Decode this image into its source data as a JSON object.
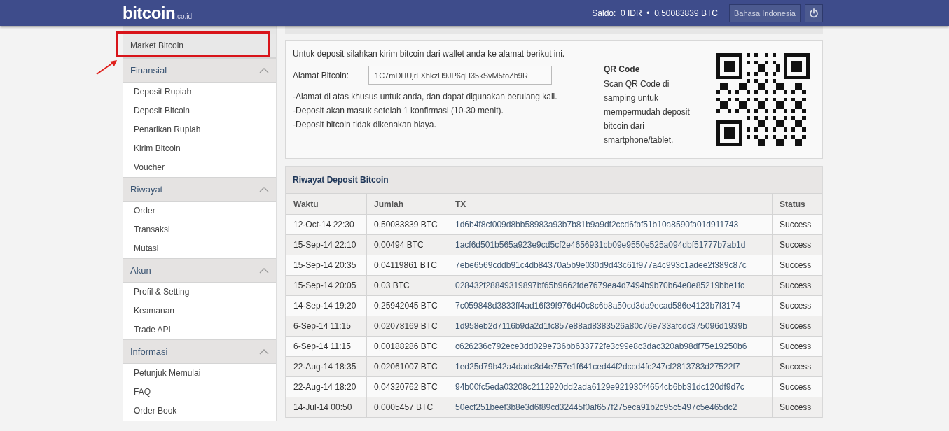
{
  "header": {
    "logo_text": "bitcoin",
    "logo_suffix": ".co.id",
    "balance_label": "Saldo:",
    "balance_idr": "0 IDR",
    "balance_separator": "•",
    "balance_btc": "0,50083839 BTC",
    "language_button": "Bahasa Indonesia"
  },
  "sidebar": {
    "top_item": {
      "label": "Market Bitcoin",
      "selected": true,
      "highlighted": true
    },
    "sections": [
      {
        "title": "Finansial",
        "expanded": true,
        "items": [
          "Deposit Rupiah",
          "Deposit Bitcoin",
          "Penarikan Rupiah",
          "Kirim Bitcoin",
          "Voucher"
        ]
      },
      {
        "title": "Riwayat",
        "expanded": true,
        "items": [
          "Order",
          "Transaksi",
          "Mutasi"
        ]
      },
      {
        "title": "Akun",
        "expanded": true,
        "items": [
          "Profil & Setting",
          "Keamanan",
          "Trade API"
        ]
      },
      {
        "title": "Informasi",
        "expanded": true,
        "items": [
          "Petunjuk Memulai",
          "FAQ",
          "Order Book"
        ]
      }
    ]
  },
  "deposit": {
    "intro": "Untuk deposit silahkan kirim bitcoin dari wallet anda ke alamat berikut ini.",
    "address_label": "Alamat Bitcoin:",
    "address": "1C7mDHUjrLXhkzH9JP6qH35kSvM5foZb9R",
    "notes": [
      "-Alamat di atas khusus untuk anda, dan dapat digunakan berulang kali.",
      "-Deposit akan masuk setelah 1 konfirmasi (10-30 menit).",
      "-Deposit bitcoin tidak dikenakan biaya."
    ],
    "qr_title": "QR Code",
    "qr_text": "Scan QR Code di samping untuk mempermudah deposit bitcoin dari smartphone/tablet."
  },
  "history": {
    "title": "Riwayat Deposit Bitcoin",
    "columns": [
      "Waktu",
      "Jumlah",
      "TX",
      "Status"
    ],
    "rows": [
      [
        "12-Oct-14 22:30",
        "0,50083839 BTC",
        "1d6b4f8cf009d8bb58983a93b7b81b9a9df2ccd6fbf51b10a8590fa01d911743",
        "Success"
      ],
      [
        "15-Sep-14 22:10",
        "0,00494 BTC",
        "1acf6d501b565a923e9cd5cf2e4656931cb09e9550e525a094dbf51777b7ab1d",
        "Success"
      ],
      [
        "15-Sep-14 20:35",
        "0,04119861 BTC",
        "7ebe6569cddb91c4db84370a5b9e030d9d43c61f977a4c993c1adee2f389c87c",
        "Success"
      ],
      [
        "15-Sep-14 20:05",
        "0,03 BTC",
        "028432f28849319897bf65b9662fde7679ea4d7494b9b70b64e0e85219bbe1fc",
        "Success"
      ],
      [
        "14-Sep-14 19:20",
        "0,25942045 BTC",
        "7c059848d3833ff4ad16f39f976d40c8c6b8a50cd3da9ecad586e4123b7f3174",
        "Success"
      ],
      [
        "6-Sep-14 11:15",
        "0,02078169 BTC",
        "1d958eb2d7116b9da2d1fc857e88ad8383526a80c76e733afcdc375096d1939b",
        "Success"
      ],
      [
        "6-Sep-14 11:15",
        "0,00188286 BTC",
        "c626236c792ece3dd029e736bb633772fe3c99e8c3dac320ab98df75e19250b6",
        "Success"
      ],
      [
        "22-Aug-14 18:35",
        "0,02061007 BTC",
        "1ed25d79b42a4dadc8d4e757e1f641ced44f2dccd4fc247cf2813783d27522f7",
        "Success"
      ],
      [
        "22-Aug-14 18:20",
        "0,04320762 BTC",
        "94b00fc5eda03208c2112920dd2ada6129e921930f4654cb6bb31dc120df9d7c",
        "Success"
      ],
      [
        "14-Jul-14 00:50",
        "0,0005457 BTC",
        "50ecf251beef3b8e3d6f89cd32445f0af657f275eca91b2c95c5497c5e465dc2",
        "Success"
      ]
    ]
  }
}
